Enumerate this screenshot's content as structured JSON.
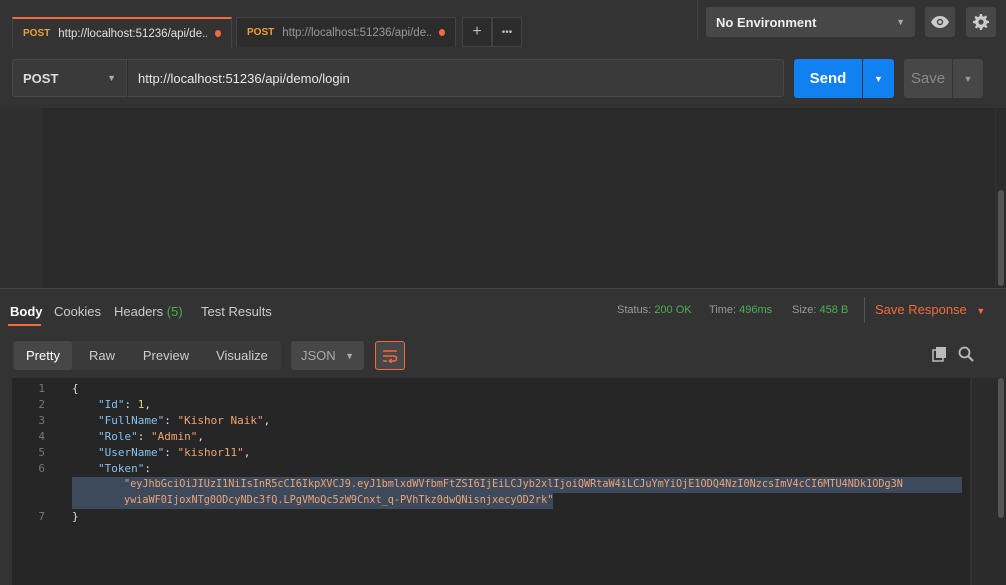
{
  "tabs": [
    {
      "method": "POST",
      "url": "http://localhost:51236/api/de..."
    },
    {
      "method": "POST",
      "url": "http://localhost:51236/api/de..."
    }
  ],
  "tab_actions": {
    "add": "+",
    "more": "•••"
  },
  "environment": {
    "selected": "No Environment"
  },
  "request": {
    "method": "POST",
    "url": "http://localhost:51236/api/demo/login",
    "send_label": "Send",
    "save_label": "Save"
  },
  "response_tabs": {
    "body": "Body",
    "cookies": "Cookies",
    "headers": "Headers",
    "headers_count": "(5)",
    "test_results": "Test Results"
  },
  "status": {
    "status_label": "Status:",
    "status_value": "200 OK",
    "time_label": "Time:",
    "time_value": "496ms",
    "size_label": "Size:",
    "size_value": "458 B",
    "save_response": "Save Response"
  },
  "viewer": {
    "modes": [
      "Pretty",
      "Raw",
      "Preview",
      "Visualize"
    ],
    "language": "JSON"
  },
  "response_body": {
    "line_numbers": [
      "1",
      "2",
      "3",
      "4",
      "5",
      "6",
      "",
      "7"
    ],
    "open_brace": "{",
    "close_brace": "}",
    "id_key": "\"Id\"",
    "id_value": "1",
    "fullname_key": "\"FullName\"",
    "fullname_value": "\"Kishor Naik\"",
    "role_key": "\"Role\"",
    "role_value": "\"Admin\"",
    "username_key": "\"UserName\"",
    "username_value": "\"kishor11\"",
    "token_key": "\"Token\"",
    "token_line1": "\"eyJhbGciOiJIUzI1NiIsInR5cCI6IkpXVCJ9.eyJ1bmlxdWVfbmFtZSI6IjEiLCJyb2xlIjoiQWRtaW4iLCJuYmYiOjE1ODQ4NzI0NzcsImV4cCI6MTU4NDk1ODg3N",
    "token_line2": "ywiaWF0IjoxNTg0ODcyNDc3fQ.LPgVMoQc5zW9Cnxt_q-PVhTkz0dwQNisnjxecyOD2rk\""
  },
  "colors": {
    "accent": "#f26b3a",
    "send": "#1180f0",
    "success": "#4caf50"
  }
}
